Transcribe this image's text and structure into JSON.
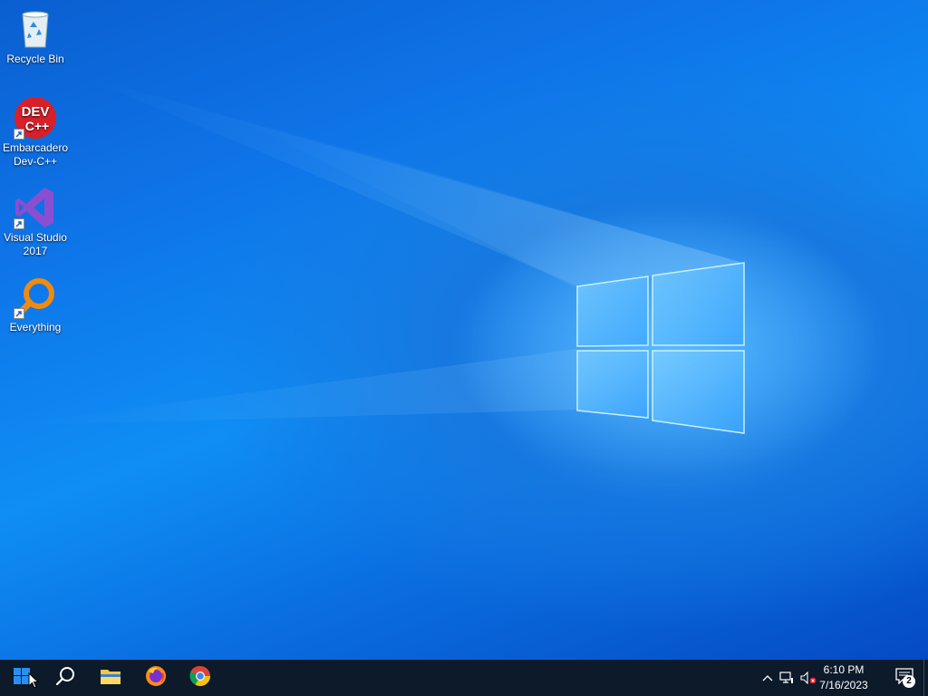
{
  "desktop": {
    "icons": [
      {
        "label": "Recycle Bin",
        "icon": "recycle-bin-icon"
      },
      {
        "label": "Embarcadero\nDev-C++",
        "icon": "devcpp-icon",
        "glyph_text_top": "DEV",
        "glyph_text_bottom": "C++"
      },
      {
        "label": "Visual Studio\n2017",
        "icon": "visual-studio-icon"
      },
      {
        "label": "Everything",
        "icon": "everything-search-icon"
      }
    ]
  },
  "taskbar": {
    "start_icon": "windows-logo-icon",
    "search_icon": "search-icon",
    "pinned": [
      {
        "name": "File Explorer",
        "icon": "folder-icon"
      },
      {
        "name": "Firefox",
        "icon": "firefox-icon"
      },
      {
        "name": "Chrome",
        "icon": "chrome-icon"
      }
    ],
    "tray": {
      "time": "6:10 PM",
      "date": "7/16/2023",
      "notification_count": "2"
    }
  },
  "colors": {
    "taskbar_bg": "#0c1a2a",
    "accent": "#0f8ef5"
  }
}
